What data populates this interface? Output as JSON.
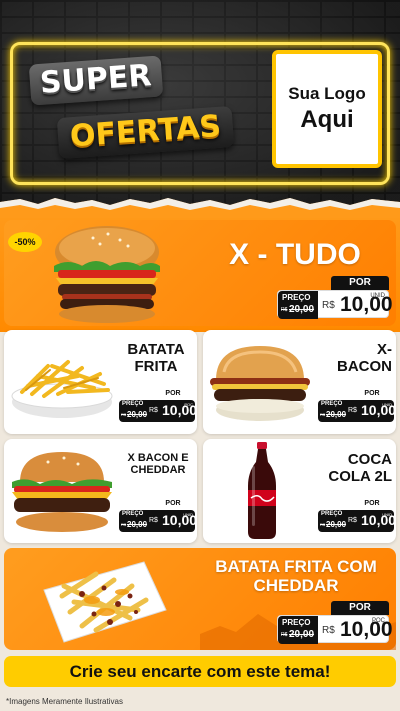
{
  "header": {
    "title_line1": "SUPER",
    "title_line2": "OFERTAS",
    "logo_line1": "Sua Logo",
    "logo_line2": "Aqui"
  },
  "featured": {
    "badge": "-50%",
    "name": "X - TUDO",
    "por": "POR",
    "preco_label": "PREÇO",
    "old_currency": "R$",
    "old_price": "20,00",
    "currency": "R$",
    "price": "10,00",
    "unit": "UNID"
  },
  "products": [
    {
      "name": "BATATA FRITA",
      "por": "POR",
      "preco_label": "PREÇO",
      "old_currency": "R$",
      "old_price": "20,00",
      "currency": "R$",
      "price": "10,00",
      "unit": "POÇ"
    },
    {
      "name": "X- BACON",
      "por": "POR",
      "preco_label": "PREÇO",
      "old_currency": "R$",
      "old_price": "20,00",
      "currency": "R$",
      "price": "10,00",
      "unit": "UNID"
    },
    {
      "name": "X BACON E CHEDDAR",
      "por": "POR",
      "preco_label": "PREÇO",
      "old_currency": "R$",
      "old_price": "20,00",
      "currency": "R$",
      "price": "10,00",
      "unit": "UNID"
    },
    {
      "name": "COCA COLA 2L",
      "por": "POR",
      "preco_label": "PREÇO",
      "old_currency": "R$",
      "old_price": "20,00",
      "currency": "R$",
      "price": "10,00",
      "unit": "UNID"
    }
  ],
  "bottom": {
    "name": "BATATA FRITA COM CHEDDAR",
    "por": "POR",
    "preco_label": "PREÇO",
    "old_currency": "R$",
    "old_price": "20,00",
    "currency": "R$",
    "price": "10,00",
    "unit": "POÇ"
  },
  "cta": "Crie seu encarte com este tema!",
  "disclaimer": "*Imagens Meramente Ilustrativas",
  "colors": {
    "orange": "#ff8a00",
    "yellow": "#ffcc00",
    "dark": "#111111",
    "brick": "#2a2a2a"
  }
}
